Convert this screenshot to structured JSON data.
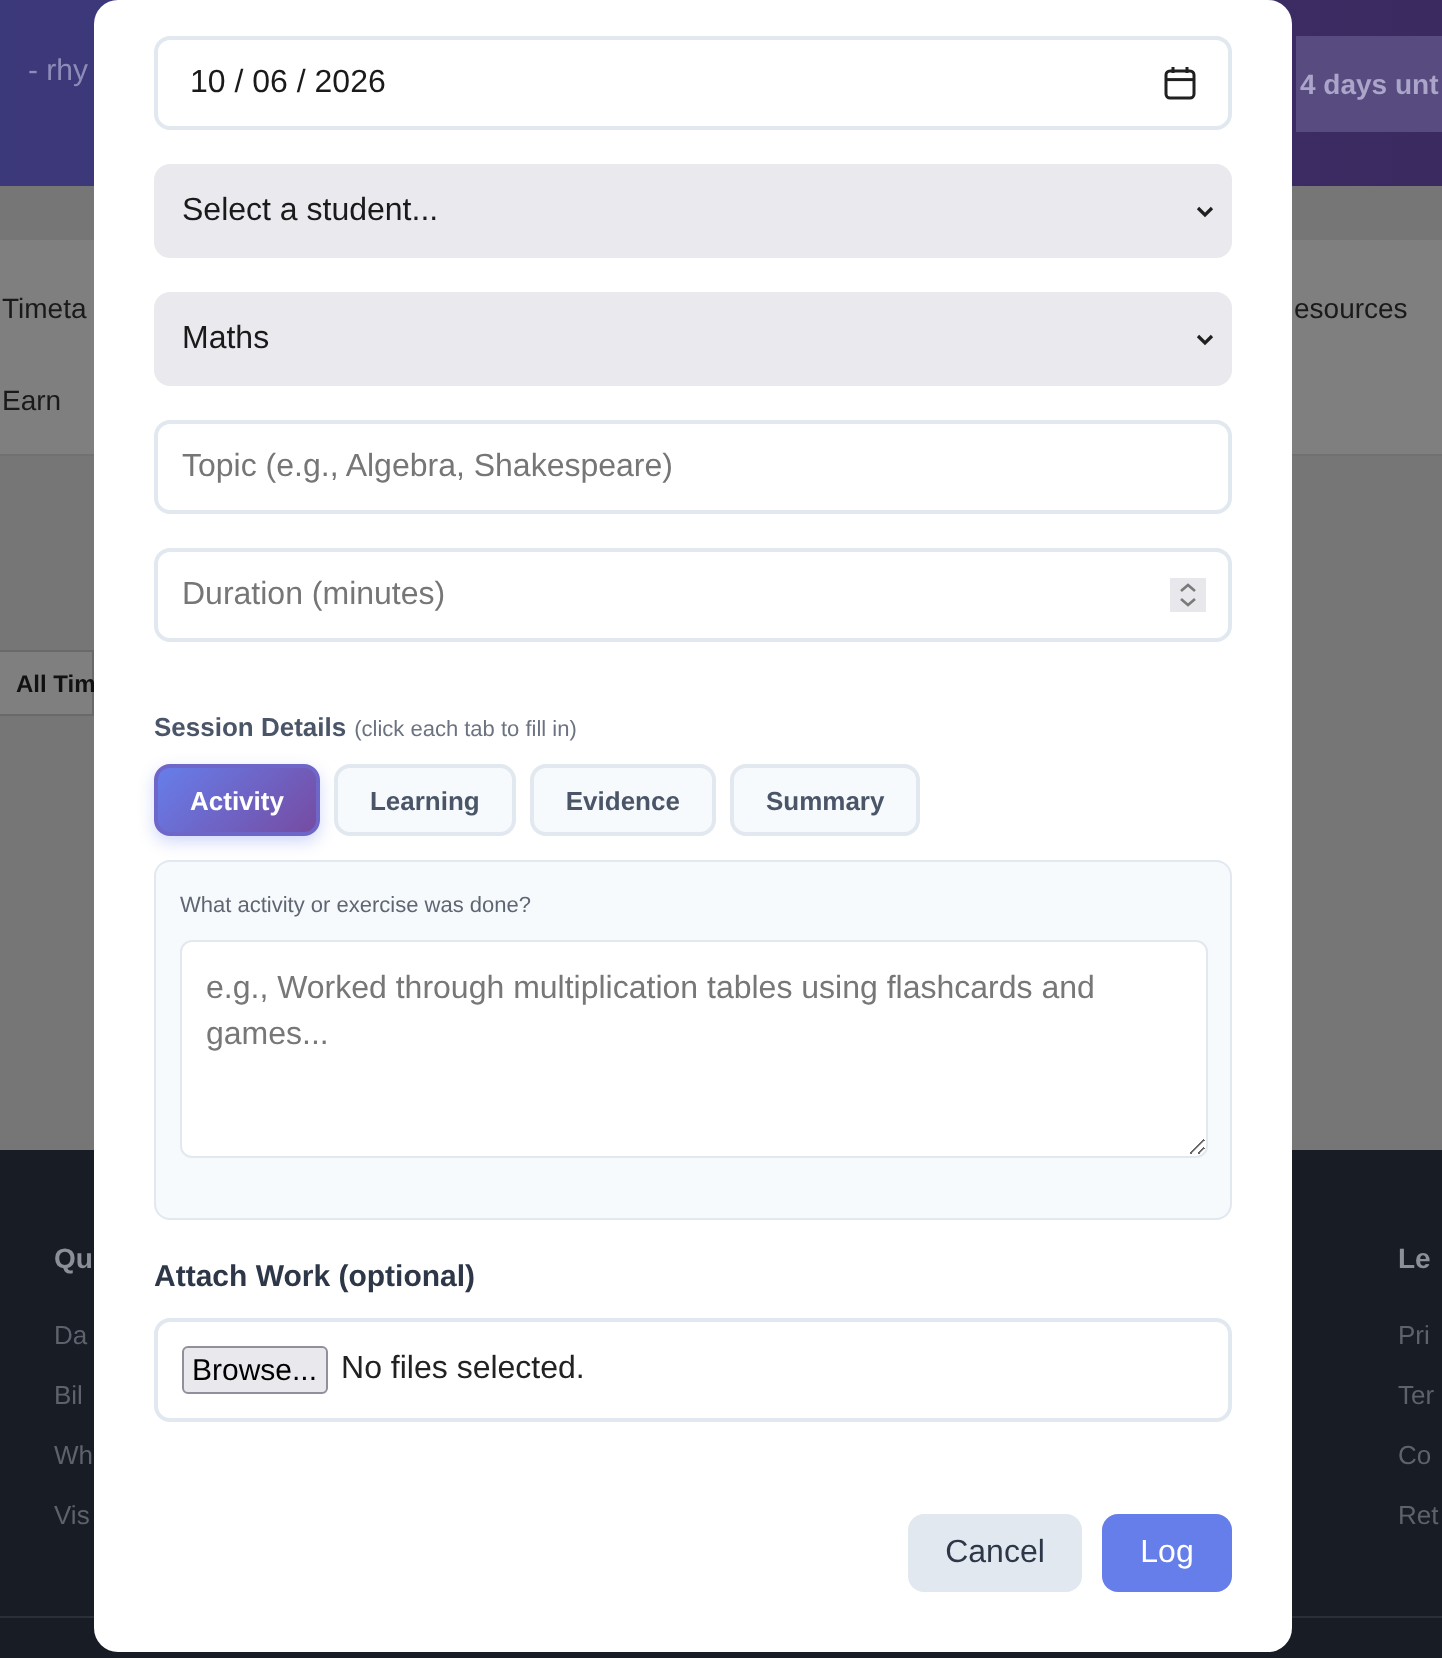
{
  "background_page": {
    "header": {
      "user_text": "- rhy",
      "countdown_badge": "4 days unt"
    },
    "nav": {
      "left_items": [
        "Timeta",
        "Earn"
      ],
      "right_items": [
        "esources"
      ]
    },
    "filter_tab": "All Tim",
    "footer": {
      "columns": [
        {
          "heading": "Qu",
          "links": [
            "Da",
            "Bil",
            "Wh",
            "Vis"
          ]
        },
        {
          "heading": "Le",
          "links": [
            "Pri",
            "Ter",
            "Co",
            "Ret"
          ]
        }
      ]
    }
  },
  "modal": {
    "fields": [
      {
        "kind": "date",
        "value": "10 / 06 / 2026"
      },
      {
        "kind": "select",
        "value": "Select a student..."
      },
      {
        "kind": "select",
        "value": "Maths"
      },
      {
        "kind": "text",
        "placeholder": "Topic (e.g., Algebra, Shakespeare)"
      },
      {
        "kind": "number",
        "placeholder": "Duration (minutes)"
      }
    ],
    "session_details": {
      "label": "Session Details",
      "hint": "(click each tab to fill in)",
      "tabs": [
        {
          "label": "Activity",
          "selected": true
        },
        {
          "label": "Learning",
          "selected": false
        },
        {
          "label": "Evidence",
          "selected": false
        },
        {
          "label": "Summary",
          "selected": false
        }
      ],
      "panel": {
        "question": "What activity or exercise was done?",
        "placeholder": "e.g., Worked through multiplication tables using flashcards and games..."
      }
    },
    "attachment": {
      "label": "Attach Work (optional)",
      "button": "Browse...",
      "status": "No files selected."
    },
    "buttons": [
      {
        "label": "Cancel",
        "kind": "secondary"
      },
      {
        "label": "Log",
        "kind": "primary"
      }
    ]
  }
}
